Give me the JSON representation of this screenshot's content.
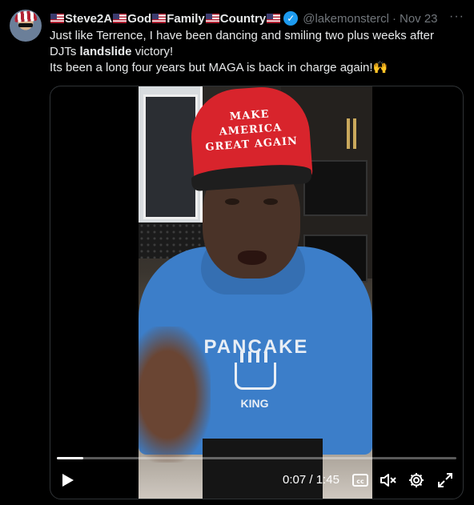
{
  "tweet": {
    "author": {
      "name_parts": [
        "Steve2A",
        "God",
        "Family",
        "Country"
      ],
      "handle": "@lakemonstercl",
      "verified": true
    },
    "date_separator": "·",
    "date": "Nov 23",
    "more_icon": "more-horizontal-icon",
    "text": {
      "line1": "Just like Terrence, I have been dancing and smiling two plus weeks after",
      "line2_before": "DJTs ",
      "line2_bold": "landslide",
      "line2_after": " victory!",
      "line3": "Its been a long four years but MAGA is back in charge again!",
      "emoji": "🙌"
    }
  },
  "video": {
    "cap_text": "MAKE AMERICA GREAT AGAIN",
    "shirt_text": "PANCAKE",
    "shirt_subtext": "KING",
    "progress": 0.067,
    "current_time": "0:07",
    "separator": " / ",
    "duration": "1:45",
    "controls": {
      "play_icon": "play-icon",
      "captions_icon": "captions-icon",
      "mute_icon": "volume-muted-icon",
      "settings_icon": "gear-icon",
      "fullscreen_icon": "fullscreen-icon"
    }
  },
  "colors": {
    "background": "#000000",
    "text": "#e7e9ea",
    "muted": "#71767b",
    "verified": "#1d9bf0",
    "cap_red": "#d8242c",
    "hoodie_blue": "#3c7ec9"
  }
}
